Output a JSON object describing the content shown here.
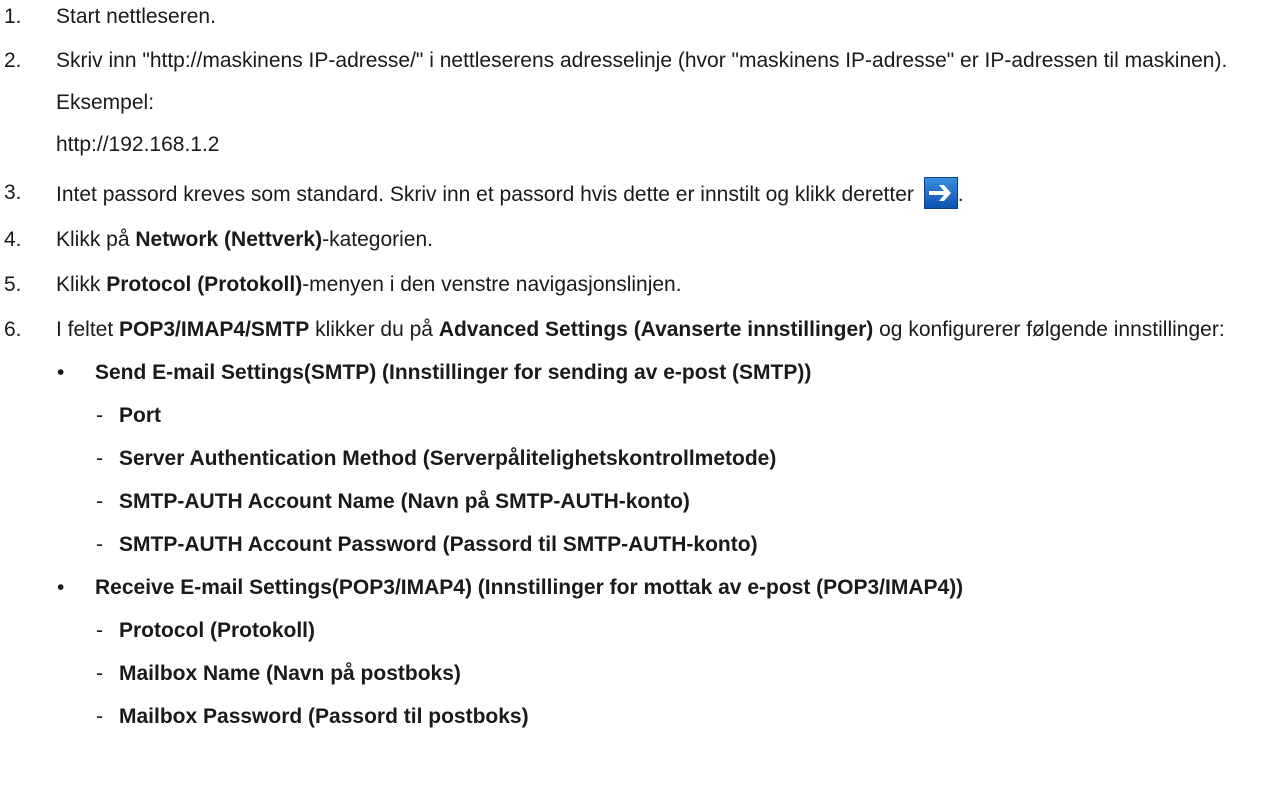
{
  "steps": [
    {
      "num": "1.",
      "text": "Start nettleseren."
    },
    {
      "num": "2.",
      "text": "Skriv inn \"http://maskinens IP-adresse/\" i nettleserens adresselinje (hvor \"maskinens IP-adresse\" er IP-adressen til maskinen).",
      "example_label": "Eksempel:",
      "example_value": "http://192.168.1.2"
    },
    {
      "num": "3.",
      "text": "Intet passord kreves som standard. Skriv inn et passord hvis dette er innstilt og klikk deretter ",
      "text_end": ".",
      "icon": "blue-arrow-right-icon"
    },
    {
      "num": "4.",
      "pre": "Klikk på ",
      "bold": "Network (Nettverk)",
      "post": "-kategorien."
    },
    {
      "num": "5.",
      "pre": "Klikk ",
      "bold": "Protocol (Protokoll)",
      "post": "-menyen i den venstre navigasjonslinjen."
    },
    {
      "num": "6.",
      "pre": "I feltet ",
      "bold1": "POP3/IMAP4/SMTP",
      "mid": " klikker du på ",
      "bold2": "Advanced Settings (Avanserte innstillinger)",
      "post": " og konfigurerer følgende innstillinger:"
    }
  ],
  "bullet_char": "•",
  "dash_char": "-",
  "send_group": {
    "title": "Send E-mail Settings(SMTP) (Innstillinger for sending av e-post (SMTP))",
    "items": [
      "Port",
      "Server Authentication Method (Serverpålitelighetskontrollmetode)",
      "SMTP-AUTH Account Name (Navn på SMTP-AUTH-konto)",
      "SMTP-AUTH Account Password (Passord til SMTP-AUTH-konto)"
    ]
  },
  "receive_group": {
    "title": "Receive E-mail Settings(POP3/IMAP4) (Innstillinger for mottak av e-post (POP3/IMAP4))",
    "items": [
      "Protocol (Protokoll)",
      "Mailbox Name (Navn på postboks)",
      "Mailbox Password (Passord til postboks)"
    ]
  },
  "colors": {
    "text": "#1a1a1a",
    "arrow_bg_top": "#3d8fe0",
    "arrow_bg_bottom": "#0b4fb0",
    "arrow_fg": "#ffffff"
  }
}
